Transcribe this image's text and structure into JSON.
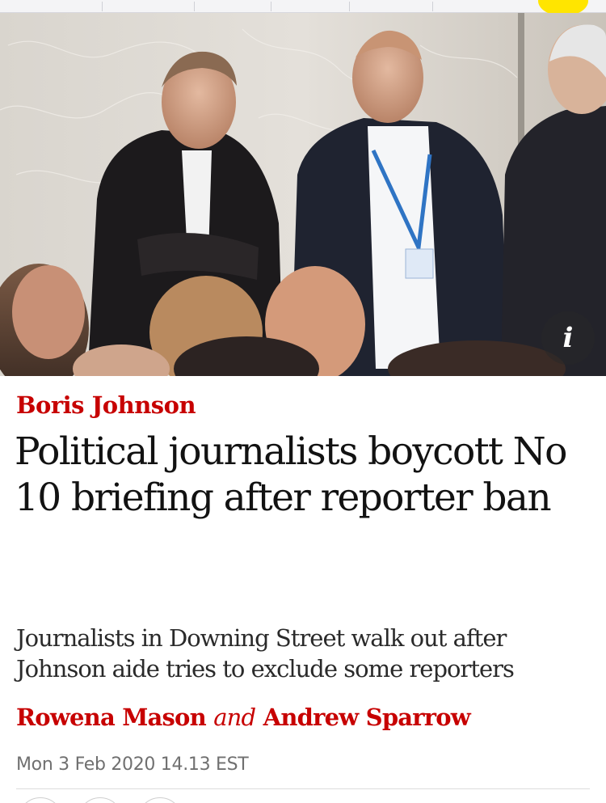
{
  "article": {
    "kicker": "Boris Johnson",
    "headline": "Political journalists boycott No 10 briefing after reporter ban",
    "standfirst": "Journalists in Downing Street walk out after Johnson aide tries to exclude some reporters",
    "byline": {
      "author1": "Rowena Mason",
      "conjunction": "and",
      "author2": "Andrew Sparrow"
    },
    "date": "Mon 3 Feb 2020 14.13 EST"
  },
  "hero": {
    "info_button_icon": "info-icon",
    "info_glyph": "i"
  },
  "colors": {
    "accent": "#c70000",
    "headline": "#121212",
    "meta": "#707070",
    "brand_badge": "#ffe500"
  }
}
